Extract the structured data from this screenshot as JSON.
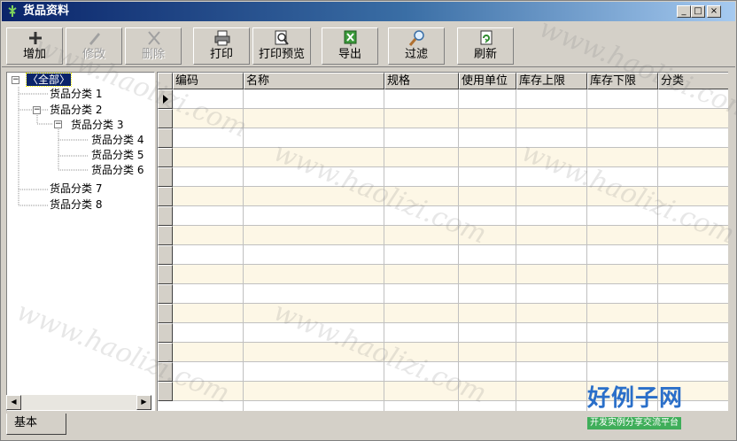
{
  "window": {
    "title": "货品资料",
    "min_label": "_",
    "max_label": "□",
    "close_label": "×"
  },
  "toolbar": {
    "buttons": [
      {
        "label": "增加",
        "icon": "add-icon",
        "enabled": true
      },
      {
        "label": "修改",
        "icon": "edit-icon",
        "enabled": false
      },
      {
        "label": "删除",
        "icon": "delete-icon",
        "enabled": false
      },
      {
        "label": "打印",
        "icon": "printer-icon",
        "enabled": true
      },
      {
        "label": "打印预览",
        "icon": "print-preview-icon",
        "enabled": true
      },
      {
        "label": "导出",
        "icon": "export-icon",
        "enabled": true
      },
      {
        "label": "过滤",
        "icon": "filter-icon",
        "enabled": true
      },
      {
        "label": "刷新",
        "icon": "refresh-icon",
        "enabled": true
      }
    ]
  },
  "tree": {
    "root": "〈全部〉",
    "nodes": [
      {
        "label": "货品分类 1"
      },
      {
        "label": "货品分类 2"
      },
      {
        "label": "货品分类 3"
      },
      {
        "label": "货品分类 4"
      },
      {
        "label": "货品分类 5"
      },
      {
        "label": "货品分类 6"
      },
      {
        "label": "货品分类 7"
      },
      {
        "label": "货品分类 8"
      }
    ]
  },
  "grid": {
    "columns": [
      "编码",
      "名称",
      "规格",
      "使用单位",
      "库存上限",
      "库存下限",
      "分类"
    ],
    "row_count": 16
  },
  "status": {
    "tab_label": "基本"
  },
  "watermark": {
    "text": "www.haolizi.com",
    "logo_main": "好例子网",
    "logo_sub": "开发实例分享交流平台"
  },
  "colors": {
    "title_bar": "#0a246a",
    "selection": "#0a246a",
    "alt_row": "#fdf7e6",
    "logo_blue": "#2a6fc9",
    "logo_green": "#3fae5a"
  }
}
